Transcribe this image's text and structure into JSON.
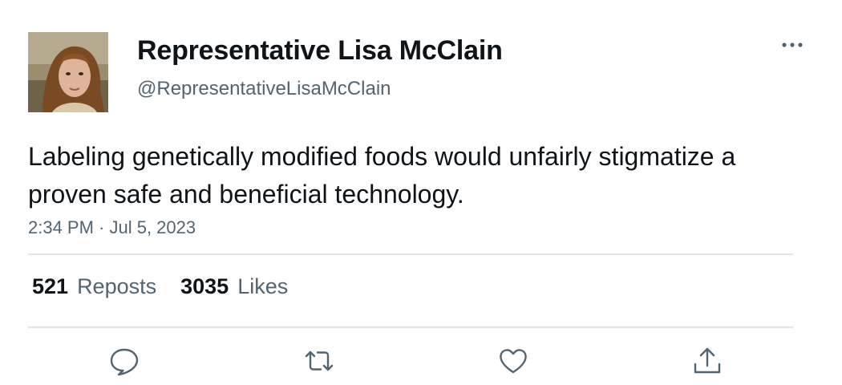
{
  "author": {
    "display_name": "Representative Lisa McClain",
    "handle": "@RepresentativeLisaMcClain",
    "avatar_icon": "profile-photo"
  },
  "tweet": {
    "text": "Labeling genetically modified foods would unfairly stigmatize a proven safe and beneficial technology.",
    "timestamp": "2:34 PM · Jul 5, 2023"
  },
  "stats": {
    "reposts_count": "521",
    "reposts_label": "Reposts",
    "likes_count": "3035",
    "likes_label": "Likes"
  },
  "actions": {
    "reply_icon": "speech-bubble-icon",
    "repost_icon": "repost-arrows-icon",
    "like_icon": "heart-icon",
    "share_icon": "share-upload-icon"
  },
  "colors": {
    "primary_text": "#0f1419",
    "secondary_text": "#536471",
    "divider": "#e1e5e8"
  }
}
